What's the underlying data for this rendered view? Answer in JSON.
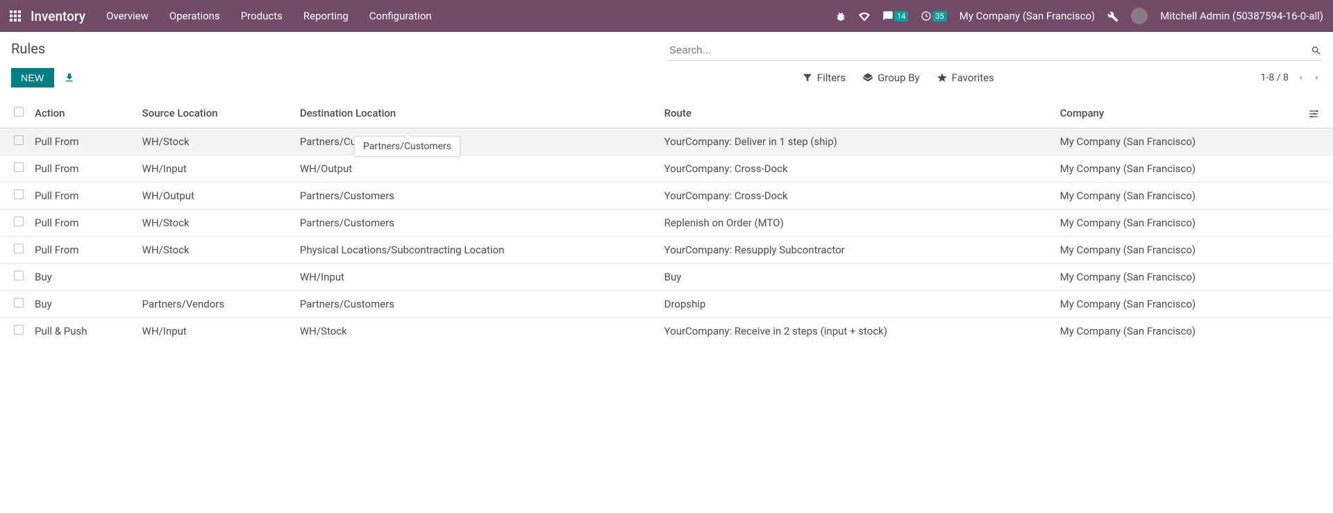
{
  "navbar": {
    "brand": "Inventory",
    "links": [
      "Overview",
      "Operations",
      "Products",
      "Reporting",
      "Configuration"
    ],
    "messages_badge": "14",
    "activities_badge": "35",
    "company": "My Company (San Francisco)",
    "user": "Mitchell Admin (50387594-16-0-all)"
  },
  "control": {
    "title": "Rules",
    "new_label": "NEW",
    "search_placeholder": "Search...",
    "filters_label": "Filters",
    "groupby_label": "Group By",
    "favorites_label": "Favorites",
    "pager": "1-8 / 8"
  },
  "table": {
    "headers": {
      "action": "Action",
      "source": "Source Location",
      "destination": "Destination Location",
      "route": "Route",
      "company": "Company"
    },
    "rows": [
      {
        "action": "Pull From",
        "source": "WH/Stock",
        "destination": "Partners/Customers",
        "route": "YourCompany: Deliver in 1 step (ship)",
        "company": "My Company (San Francisco)"
      },
      {
        "action": "Pull From",
        "source": "WH/Input",
        "destination": "WH/Output",
        "route": "YourCompany: Cross-Dock",
        "company": "My Company (San Francisco)"
      },
      {
        "action": "Pull From",
        "source": "WH/Output",
        "destination": "Partners/Customers",
        "route": "YourCompany: Cross-Dock",
        "company": "My Company (San Francisco)"
      },
      {
        "action": "Pull From",
        "source": "WH/Stock",
        "destination": "Partners/Customers",
        "route": "Replenish on Order (MTO)",
        "company": "My Company (San Francisco)"
      },
      {
        "action": "Pull From",
        "source": "WH/Stock",
        "destination": "Physical Locations/Subcontracting Location",
        "route": "YourCompany: Resupply Subcontractor",
        "company": "My Company (San Francisco)"
      },
      {
        "action": "Buy",
        "source": "",
        "destination": "WH/Input",
        "route": "Buy",
        "company": "My Company (San Francisco)"
      },
      {
        "action": "Buy",
        "source": "Partners/Vendors",
        "destination": "Partners/Customers",
        "route": "Dropship",
        "company": "My Company (San Francisco)"
      },
      {
        "action": "Pull & Push",
        "source": "WH/Input",
        "destination": "WH/Stock",
        "route": "YourCompany: Receive in 2 steps (input + stock)",
        "company": "My Company (San Francisco)"
      }
    ]
  },
  "tooltip": {
    "text": "Partners/Customers"
  }
}
